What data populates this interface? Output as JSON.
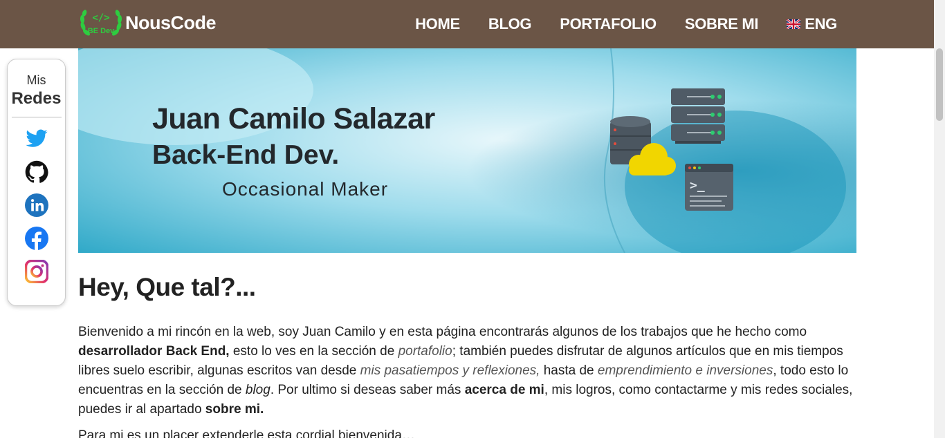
{
  "navbar": {
    "logo_badge": "BE Dev",
    "logo_text": "NousCode",
    "links": [
      "HOME",
      "BLOG",
      "PORTAFOLIO",
      "SOBRE MI"
    ],
    "lang_label": "ENG"
  },
  "social": {
    "title_small": "Mis",
    "title_big": "Redes",
    "icons": [
      "twitter-icon",
      "github-icon",
      "linkedin-icon",
      "facebook-icon",
      "instagram-icon"
    ]
  },
  "banner": {
    "name": "Juan Camilo Salazar",
    "role": "Back-End Dev.",
    "subtitle": "Occasional Maker"
  },
  "content": {
    "heading": "Hey, Que tal?...",
    "p1_a": "Bienvenido a mi rincón en la web, soy Juan Camilo y en esta página encontrarás algunos de los trabajos que he hecho como ",
    "p1_b": "desarrollador Back End,",
    "p1_c": " esto lo ves en la sección de ",
    "p1_d": "portafolio",
    "p1_e": "; también puedes disfrutar de algunos artículos que en mis tiempos libres suelo escribir, algunas escritos van desde ",
    "p1_f": "mis pasatiempos y reflexiones,",
    "p1_g": " hasta de ",
    "p1_h": "emprendimiento e inversiones",
    "p1_i": ", todo esto lo encuentras en la sección de ",
    "p1_j": "blog",
    "p1_k": ". Por ultimo si deseas saber más ",
    "p1_l": "acerca de mi",
    "p1_m": ", mis logros, como contactarme y mis redes sociales, puedes ir al apartado ",
    "p1_n": "sobre mi.",
    "p2": "Para mi es un placer extenderle esta cordial bienvenida…"
  },
  "colors": {
    "navbar_bg": "#6b5546",
    "logo_green": "#2ecc40",
    "banner_blue": "#4fc3d9"
  }
}
